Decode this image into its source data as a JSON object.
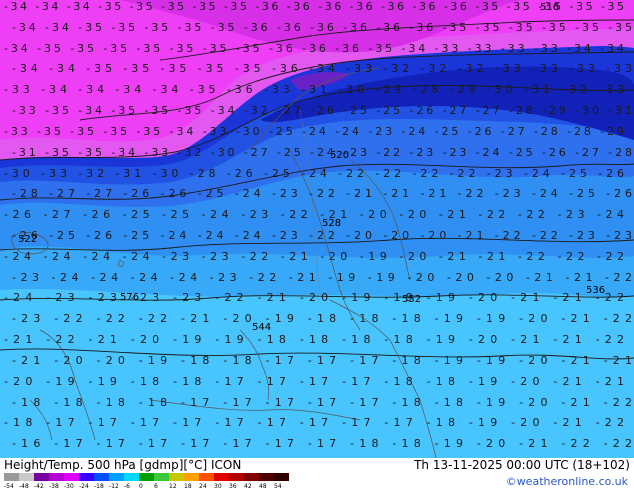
{
  "header": {
    "title": "Height/Temp. 500 hPa [gdmp][°C] ICON",
    "valid_time": "Th 13-11-2025 00:00 UTC (18+102)",
    "watermark": "©weatheronline.co.uk"
  },
  "legend": {
    "ticks": [
      "-54",
      "-48",
      "-42",
      "-38",
      "-30",
      "-24",
      "-18",
      "-12",
      "-6",
      "0",
      "6",
      "12",
      "18",
      "24",
      "30",
      "36",
      "42",
      "48",
      "54"
    ],
    "colors": [
      "#9a9a9a",
      "#c9c9c9",
      "#7a00a0",
      "#b400d4",
      "#e000ff",
      "#3a00ff",
      "#0050ff",
      "#00a0ff",
      "#00d8ff",
      "#00a000",
      "#3cc83c",
      "#c8c800",
      "#ffa000",
      "#ff5000",
      "#e00000",
      "#b40000",
      "#800000",
      "#500000",
      "#300000"
    ]
  },
  "map": {
    "contour_labels": [
      "576",
      "552",
      "544",
      "536",
      "528",
      "522",
      "520",
      "516"
    ],
    "temperature_rows": [
      "-34 -34 -34 -35 -35 -35 -35 -35 -36 -36 -36 -36 -36 -36 -36 -35 -35 -35 -35 -35",
      "-34 -34 -35 -35 -35 -35 -35 -36 -36 -36 -36 -36 -36 -35 -35 -35 -35 -35 -35",
      "-34 -35 -35 -35 -35 -35 -35 -35 -36 -36 -36 -35 -34 -33 -33 -33 -33 -34 -34",
      "-34 -34 -35 -35 -35 -35 -35 -36 -34 -33 -32 -32 -32 -33 -33 -33 -33",
      "-33 -34 -34 -34 -34 -35 -36 -33 -31 -30 -29 -28 -29 -30 -31 -32 -33",
      "-33 -35 -34 -35 -35 -35 -34 -32 -27 -26 -25 -25 -26 -27 -27 -28 -29 -30 -31",
      "-33 -35 -35 -35 -35 -34 -33 -30 -25 -24 -24 -23 -24 -25 -26 -27 -28 -28 -29",
      "-31 -35 -35 -34 -33 -32 -30 -27 -25 -24 -23 -22 -23 -23 -24 -25 -26 -27 -28",
      "-30 -33 -32 -31 -30 -28 -26 -25 -24 -22 -22 -22 -22 -23 -24 -25 -26",
      "-28 -27 -27 -26 -26 -25 -24 -23 -22 -21 -21 -21 -22 -23 -24 -25 -26",
      "-26 -27 -26 -25 -25 -24 -23 -22 -21 -20 -20 -21 -22 -22 -23 -24",
      "-26 -25 -26 -25 -24 -24 -24 -23 -22 -20 -20 -20 -21 -22 -22 -23 -23",
      "-24 -24 -24 -24 -23 -23 -22 -21 -20 -19 -20 -21 -21 -22 -22 -22",
      "-23 -24 -24 -24 -24 -23 -22 -21 -19 -19 -20 -20 -20 -21 -21 -22",
      "-24 -23 -23 -23 -23 -22 -21 -20 -19 -19 -19 -20 -21 -21 -22",
      "-23 -22 -22 -22 -21 -20 -19 -18 -18 -18 -19 -19 -20 -21 -22",
      "-21 -22 -21 -20 -19 -19 -18 -18 -18 -18 -19 -20 -21 -21 -22",
      "-21 -20 -20 -19 -18 -18 -17 -17 -17 -18 -19 -19 -20 -21 -21",
      "-20 -19 -19 -18 -18 -17 -17 -17 -17 -18 -18 -19 -20 -21 -21",
      "-18 -18 -18 -18 -17 -17 -17 -17 -17 -18 -18 -19 -20 -21 -22",
      "-18 -17 -17 -17 -17 -17 -17 -17 -17 -17 -18 -19 -20 -21 -22",
      "-16 -17 -17 -17 -17 -17 -17 -17 -18 -18 -19 -20 -21 -22 -22"
    ]
  }
}
